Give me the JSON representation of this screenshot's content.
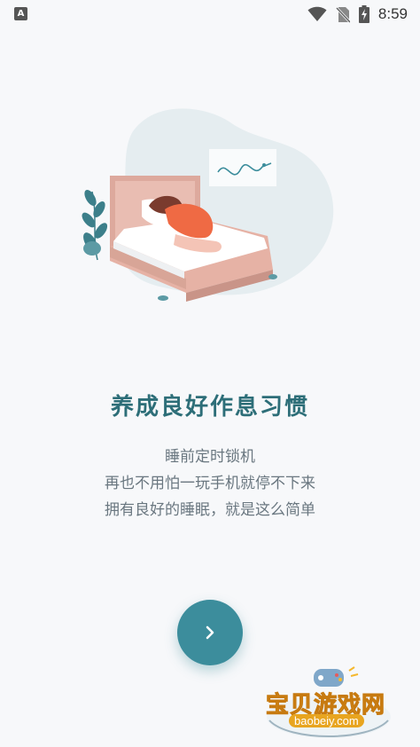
{
  "status_bar": {
    "left_icon": "A",
    "time": "8:59",
    "icons": [
      "notification-a-icon",
      "wifi-icon",
      "no-sim-icon",
      "battery-charging-icon"
    ]
  },
  "onboarding": {
    "title": "养成良好作息习惯",
    "description_lines": [
      "睡前定时锁机",
      "再也不用怕一玩手机就停不下来",
      "拥有良好的睡眠，就是这么简单"
    ],
    "next_icon": "chevron-right-icon"
  },
  "watermark": {
    "text": "宝贝游戏网",
    "url": "baobeiy.com"
  },
  "colors": {
    "background": "#f7f8fa",
    "title": "#2d6e78",
    "description": "#6a7780",
    "accent_button": "#3c8d9c"
  }
}
